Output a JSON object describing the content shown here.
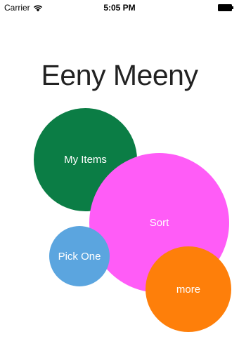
{
  "status_bar": {
    "carrier": "Carrier",
    "time": "5:05 PM",
    "icons": [
      "wifi-icon",
      "battery-icon"
    ]
  },
  "app": {
    "title": "Eeny Meeny"
  },
  "bubbles": [
    {
      "label": "My Items",
      "color": "#0b7d45"
    },
    {
      "label": "Sort",
      "color": "#ff5cf7"
    },
    {
      "label": "Pick One",
      "color": "#5ba5df"
    },
    {
      "label": "more",
      "color": "#fe7f0a"
    }
  ]
}
